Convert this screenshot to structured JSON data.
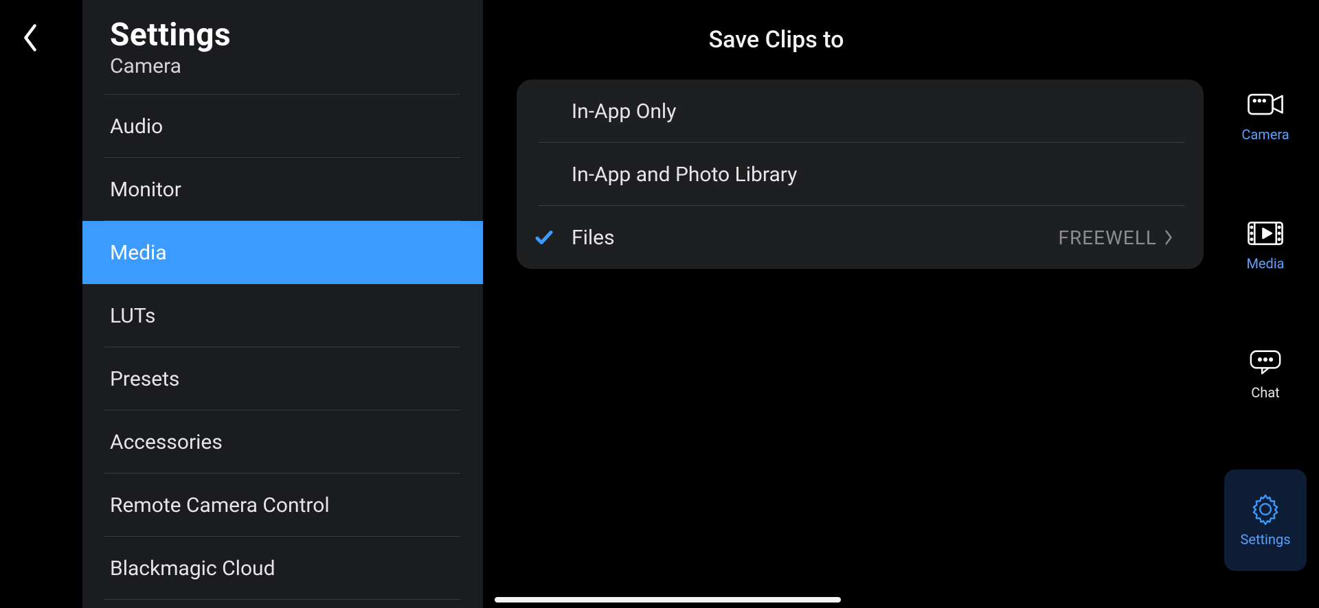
{
  "sidebar": {
    "title": "Settings",
    "items": [
      {
        "label": "Camera",
        "cut": true
      },
      {
        "label": "Audio"
      },
      {
        "label": "Monitor"
      },
      {
        "label": "Media",
        "selected": true
      },
      {
        "label": "LUTs"
      },
      {
        "label": "Presets"
      },
      {
        "label": "Accessories"
      },
      {
        "label": "Remote Camera Control"
      },
      {
        "label": "Blackmagic Cloud"
      }
    ]
  },
  "detail": {
    "title": "Save Clips to",
    "options": [
      {
        "label": "In-App Only",
        "selected": false
      },
      {
        "label": "In-App and Photo Library",
        "selected": false
      },
      {
        "label": "Files",
        "selected": true,
        "value": "FREEWELL",
        "disclosure": true
      }
    ]
  },
  "rail": {
    "items": [
      {
        "label": "Camera",
        "icon": "camera-icon"
      },
      {
        "label": "Media",
        "icon": "media-icon"
      },
      {
        "label": "Chat",
        "icon": "chat-icon",
        "white": true
      },
      {
        "label": "Settings",
        "icon": "settings-icon",
        "selected": true
      }
    ]
  },
  "icons": {
    "back": "chevron-left-icon",
    "check": "check-icon",
    "chevron_right": "chevron-right-icon"
  }
}
